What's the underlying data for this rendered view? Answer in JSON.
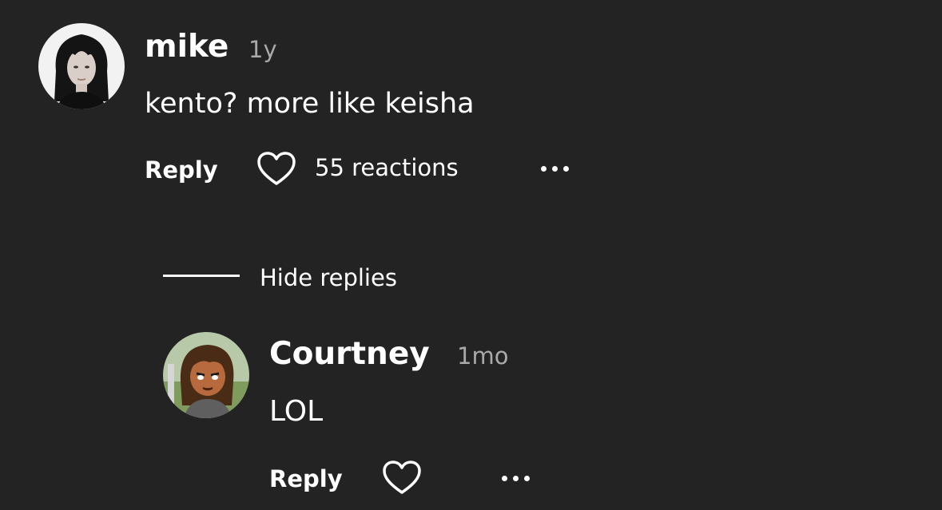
{
  "comment": {
    "username": "mike",
    "timestamp": "1y",
    "text": "kento? more like keisha",
    "reply_label": "Reply",
    "reactions_label": "55 reactions",
    "avatar_icon": "person-avatar-photo"
  },
  "replies_toggle": {
    "label": "Hide replies"
  },
  "reply": {
    "username": "Courtney",
    "timestamp": "1mo",
    "text": "LOL",
    "reply_label": "Reply",
    "avatar_icon": "cartoon-avatar"
  },
  "colors": {
    "background": "#232323",
    "text": "#ffffff",
    "muted": "#a9a9a9"
  }
}
